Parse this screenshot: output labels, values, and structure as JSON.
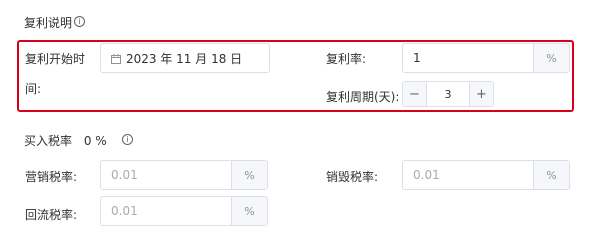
{
  "compound": {
    "section_title": "复利说明",
    "info_icon": "info-circle-icon",
    "start_time_label_line1": "复利开始时",
    "start_time_label_line2": "间:",
    "start_date_value": "2023 年 11 月 18 日",
    "calendar_icon": "calendar-icon",
    "rate_label": "复利率:",
    "rate_value": "1",
    "rate_unit": "%",
    "period_label": "复利周期(天):",
    "period_value": "3",
    "minus_label": "−",
    "plus_label": "+"
  },
  "buy_tax": {
    "section_title": "买入税率",
    "section_value": "0 %",
    "marketing_label": "营销税率:",
    "marketing_placeholder": "0.01",
    "marketing_unit": "%",
    "destroy_label": "销毁税率:",
    "destroy_placeholder": "0.01",
    "destroy_unit": "%",
    "reflow_label": "回流税率:",
    "reflow_placeholder": "0.01",
    "reflow_unit": "%"
  },
  "colors": {
    "highlight_border": "#d9001b",
    "input_border": "#dcdfe6",
    "placeholder": "#a8abb2"
  }
}
